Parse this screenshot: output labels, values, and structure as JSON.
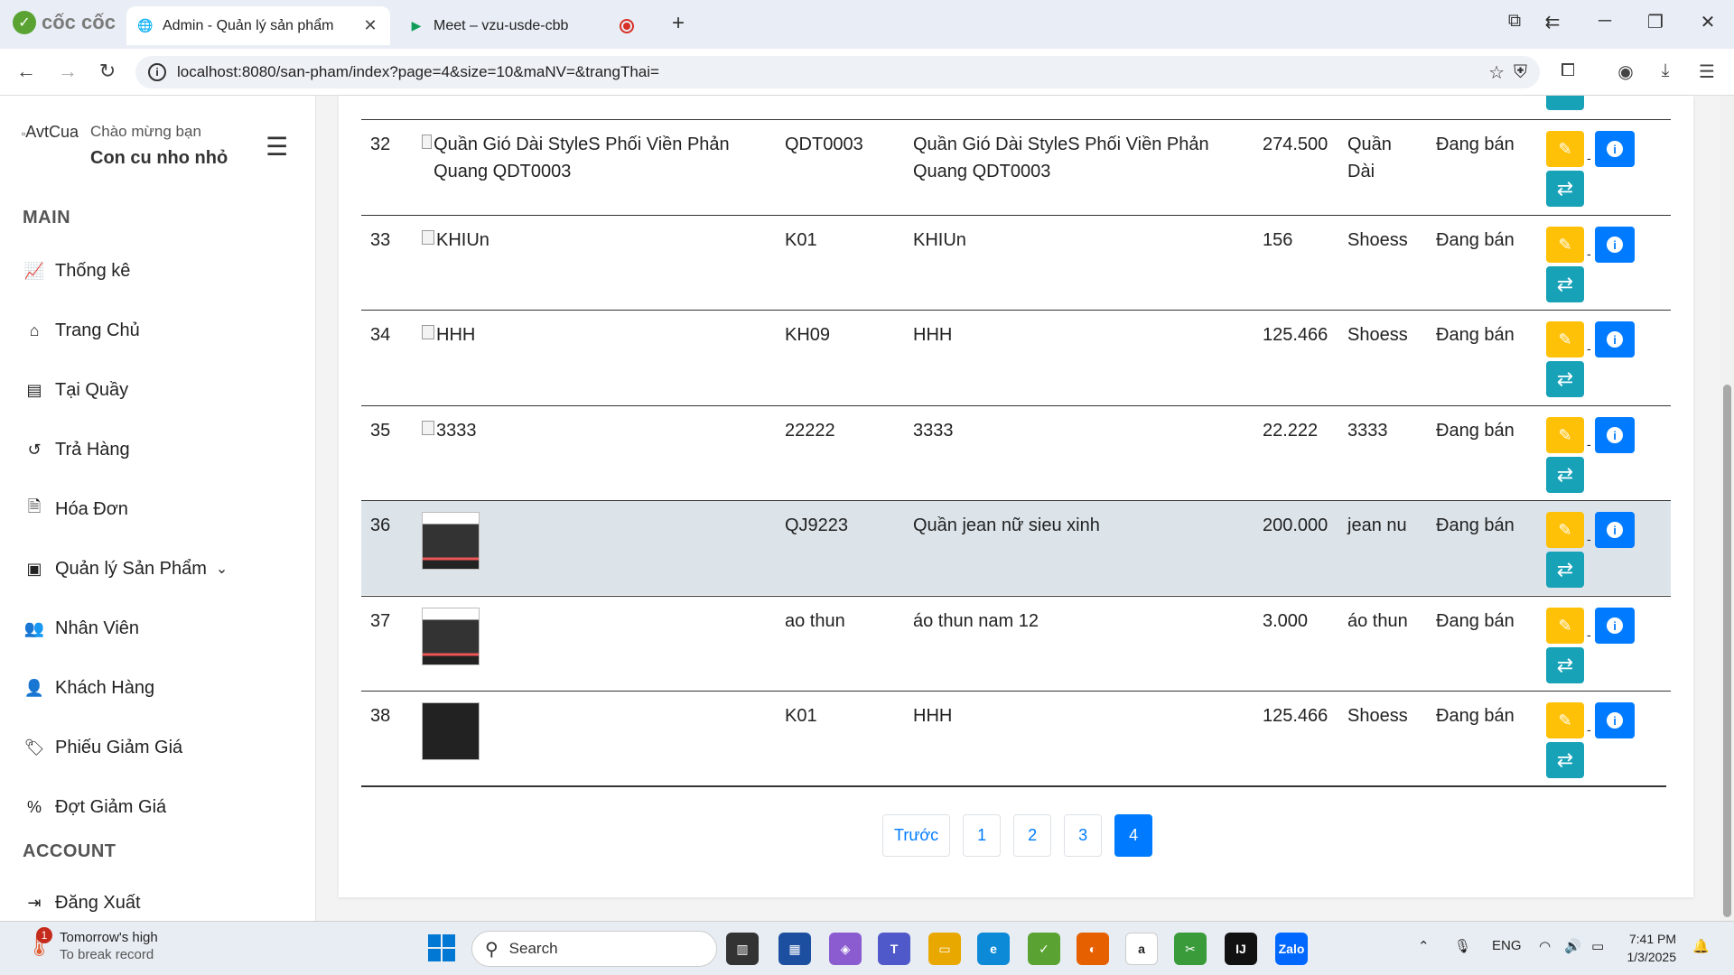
{
  "browser": {
    "brand": "cốc cốc",
    "tabs": [
      {
        "title": "Admin - Quản lý sản phẩm",
        "active": true
      },
      {
        "title": "Meet – vzu-usde-cbb",
        "active": false
      }
    ],
    "url": "localhost:8080/san-pham/index?page=4&size=10&maNV=&trangThai="
  },
  "sidebar": {
    "avatar_alt": "AvtCua",
    "greeting": "Chào mừng bạn",
    "username": "Con cu nho nhỏ",
    "section_main": "MAIN",
    "section_account": "ACCOUNT",
    "items": [
      {
        "label": "Thống kê",
        "icon": "chart-line-icon"
      },
      {
        "label": "Trang Chủ",
        "icon": "home-icon"
      },
      {
        "label": "Tại Quầy",
        "icon": "cash-register-icon"
      },
      {
        "label": "Trả Hàng",
        "icon": "undo-icon"
      },
      {
        "label": "Hóa Đơn",
        "icon": "invoice-icon"
      },
      {
        "label": "Quản lý Sản Phẩm",
        "icon": "box-icon"
      },
      {
        "label": "Nhân Viên",
        "icon": "users-icon"
      },
      {
        "label": "Khách Hàng",
        "icon": "user-icon"
      },
      {
        "label": "Phiếu Giảm Giá",
        "icon": "tags-icon"
      },
      {
        "label": "Đợt Giảm Giá",
        "icon": "percent-icon"
      }
    ],
    "logout": "Đăng Xuất"
  },
  "table": {
    "rows": [
      {
        "stt": "32",
        "img_alt": "Quần Gió Dài StyleS Phối Viền Phản Quang QDT0003",
        "ma": "QDT0003",
        "ten": "Quần Gió Dài StyleS Phối Viền Phản Quang QDT0003",
        "gia": "274.500",
        "loai": "Quần Dài",
        "trang_thai": "Đang bán"
      },
      {
        "stt": "33",
        "img_alt": "KHIUn",
        "ma": "K01",
        "ten": "KHIUn",
        "gia": "156",
        "loai": "Shoess",
        "trang_thai": "Đang bán"
      },
      {
        "stt": "34",
        "img_alt": "HHH",
        "ma": "KH09",
        "ten": "HHH",
        "gia": "125.466",
        "loai": "Shoess",
        "trang_thai": "Đang bán"
      },
      {
        "stt": "35",
        "img_alt": "3333",
        "ma": "22222",
        "ten": "3333",
        "gia": "22.222",
        "loai": "3333",
        "trang_thai": "Đang bán"
      },
      {
        "stt": "36",
        "img_alt": "",
        "ma": "QJ9223",
        "ten": "Quần jean nữ sieu xinh",
        "gia": "200.000",
        "loai": "jean nu",
        "trang_thai": "Đang bán"
      },
      {
        "stt": "37",
        "img_alt": "",
        "ma": "ao thun",
        "ten": "áo thun nam 12",
        "gia": "3.000",
        "loai": "áo thun",
        "trang_thai": "Đang bán"
      },
      {
        "stt": "38",
        "img_alt": "",
        "ma": "K01",
        "ten": "HHH",
        "gia": "125.466",
        "loai": "Shoess",
        "trang_thai": "Đang bán"
      }
    ]
  },
  "pagination": {
    "prev": "Trước",
    "pages": [
      "1",
      "2",
      "3",
      "4"
    ],
    "current": "4"
  },
  "taskbar": {
    "weather_title": "Tomorrow's high",
    "weather_sub": "To break record",
    "weather_badge": "1",
    "search": "Search",
    "lang": "ENG",
    "time": "7:41 PM",
    "date": "1/3/2025"
  }
}
